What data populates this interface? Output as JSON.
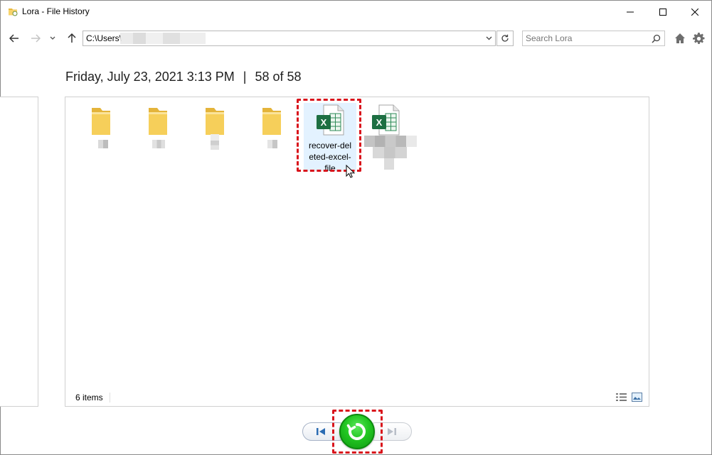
{
  "window": {
    "title": "Lora - File History"
  },
  "address": {
    "path_prefix": "C:\\Users\\"
  },
  "search": {
    "placeholder": "Search Lora"
  },
  "header": {
    "date": "Friday, July 23, 2021 3:13 PM",
    "separator": "|",
    "position": "58 of 58"
  },
  "files": [
    {
      "type": "folder",
      "label": ""
    },
    {
      "type": "folder",
      "label": ""
    },
    {
      "type": "folder",
      "label": ""
    },
    {
      "type": "folder",
      "label": ""
    },
    {
      "type": "excel",
      "label": "recover-deleted-excel-file",
      "label_lines": [
        "recover-del",
        "eted-excel-",
        "file"
      ],
      "selected": true
    },
    {
      "type": "excel",
      "label": ""
    }
  ],
  "status": {
    "item_count": "6 items"
  },
  "colors": {
    "accent_red": "#d9141c",
    "restore_green": "#22c622",
    "selection_blue": "#cce8ff",
    "excel_green": "#1d6f42",
    "folder_yellow": "#f6cf5a"
  },
  "icons": {
    "back": "arrow-left-icon",
    "forward": "arrow-right-icon",
    "recent": "chevron-down-icon",
    "up": "arrow-up-icon",
    "refresh": "refresh-icon",
    "search": "search-icon",
    "home": "home-icon",
    "settings": "gear-icon",
    "previous": "skip-back-icon",
    "restore": "restore-icon",
    "next": "skip-forward-icon"
  }
}
